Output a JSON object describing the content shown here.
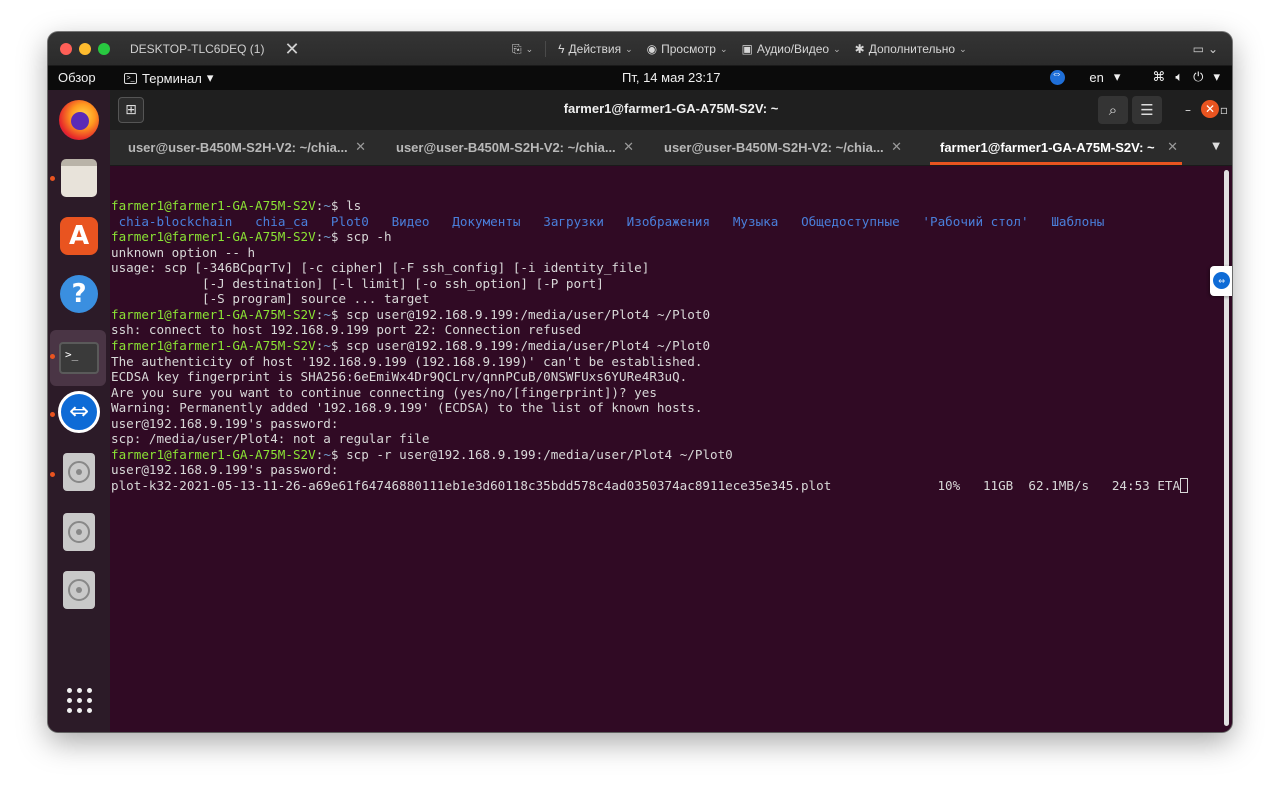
{
  "mac_bar": {
    "session_title": "DESKTOP-TLC6DEQ (1)",
    "close_label": "✕",
    "menus": [
      {
        "icon": "file-transfer-icon",
        "label": ""
      },
      {
        "icon": "lightning-icon",
        "label": "Действия"
      },
      {
        "icon": "eye-icon",
        "label": "Просмотр"
      },
      {
        "icon": "chat-icon",
        "label": "Аудио/Видео"
      },
      {
        "icon": "tools-icon",
        "label": "Дополнительно"
      }
    ]
  },
  "gnome_bar": {
    "overview": "Обзор",
    "app_menu": "Терминал",
    "clock": "Пт, 14 мая  23:17",
    "keyboard_layout": "en"
  },
  "terminal": {
    "title": "farmer1@farmer1-GA-A75M-S2V: ~",
    "tabs": [
      {
        "label": "user@user-B450M-S2H-V2: ~/chia...",
        "active": false
      },
      {
        "label": "user@user-B450M-S2H-V2: ~/chia...",
        "active": false
      },
      {
        "label": "user@user-B450M-S2H-V2: ~/chia...",
        "active": false
      },
      {
        "label": "farmer1@farmer1-GA-A75M-S2V: ~",
        "active": true
      }
    ],
    "prompt_user": "farmer1@farmer1-GA-A75M-S2V",
    "prompt_path": "~",
    "lines": [
      {
        "type": "prompt",
        "cmd": " ls"
      },
      {
        "type": "dirs",
        "items": [
          "chia-blockchain",
          "chia_ca",
          "Plot0",
          "Видео",
          "Документы",
          "Загрузки",
          "Изображения",
          "Музыка",
          "Общедоступные",
          "'Рабочий стол'",
          "Шаблоны"
        ]
      },
      {
        "type": "prompt",
        "cmd": " scp -h"
      },
      {
        "type": "text",
        "text": "unknown option -- h"
      },
      {
        "type": "text",
        "text": "usage: scp [-346BCpqrTv] [-c cipher] [-F ssh_config] [-i identity_file]"
      },
      {
        "type": "text",
        "text": "            [-J destination] [-l limit] [-o ssh_option] [-P port]"
      },
      {
        "type": "text",
        "text": "            [-S program] source ... target"
      },
      {
        "type": "prompt",
        "cmd": " scp user@192.168.9.199:/media/user/Plot4 ~/Plot0"
      },
      {
        "type": "text",
        "text": "ssh: connect to host 192.168.9.199 port 22: Connection refused"
      },
      {
        "type": "prompt",
        "cmd": " scp user@192.168.9.199:/media/user/Plot4 ~/Plot0"
      },
      {
        "type": "text",
        "text": "The authenticity of host '192.168.9.199 (192.168.9.199)' can't be established."
      },
      {
        "type": "text",
        "text": "ECDSA key fingerprint is SHA256:6eEmiWx4Dr9QCLrv/qnnPCuB/0NSWFUxs6YURe4R3uQ."
      },
      {
        "type": "text",
        "text": "Are you sure you want to continue connecting (yes/no/[fingerprint])? yes"
      },
      {
        "type": "text",
        "text": "Warning: Permanently added '192.168.9.199' (ECDSA) to the list of known hosts."
      },
      {
        "type": "text",
        "text": "user@192.168.9.199's password: "
      },
      {
        "type": "text",
        "text": "scp: /media/user/Plot4: not a regular file"
      },
      {
        "type": "prompt",
        "cmd": " scp -r user@192.168.9.199:/media/user/Plot4 ~/Plot0"
      },
      {
        "type": "text",
        "text": "user@192.168.9.199's password: "
      },
      {
        "type": "progress",
        "text": "plot-k32-2021-05-13-11-26-a69e61f64746880111eb1e3d60118c35bdd578c4ad0350374ac8911ece35e345.plot              10%   11GB  62.1MB/s   24:53 ETA"
      }
    ]
  },
  "dock": {
    "items": [
      "firefox-icon",
      "files-icon",
      "app-store-icon",
      "help-icon",
      "terminal-icon",
      "teamviewer-icon",
      "disk-icon",
      "disk-icon",
      "disk-icon",
      "show-apps-icon"
    ]
  }
}
